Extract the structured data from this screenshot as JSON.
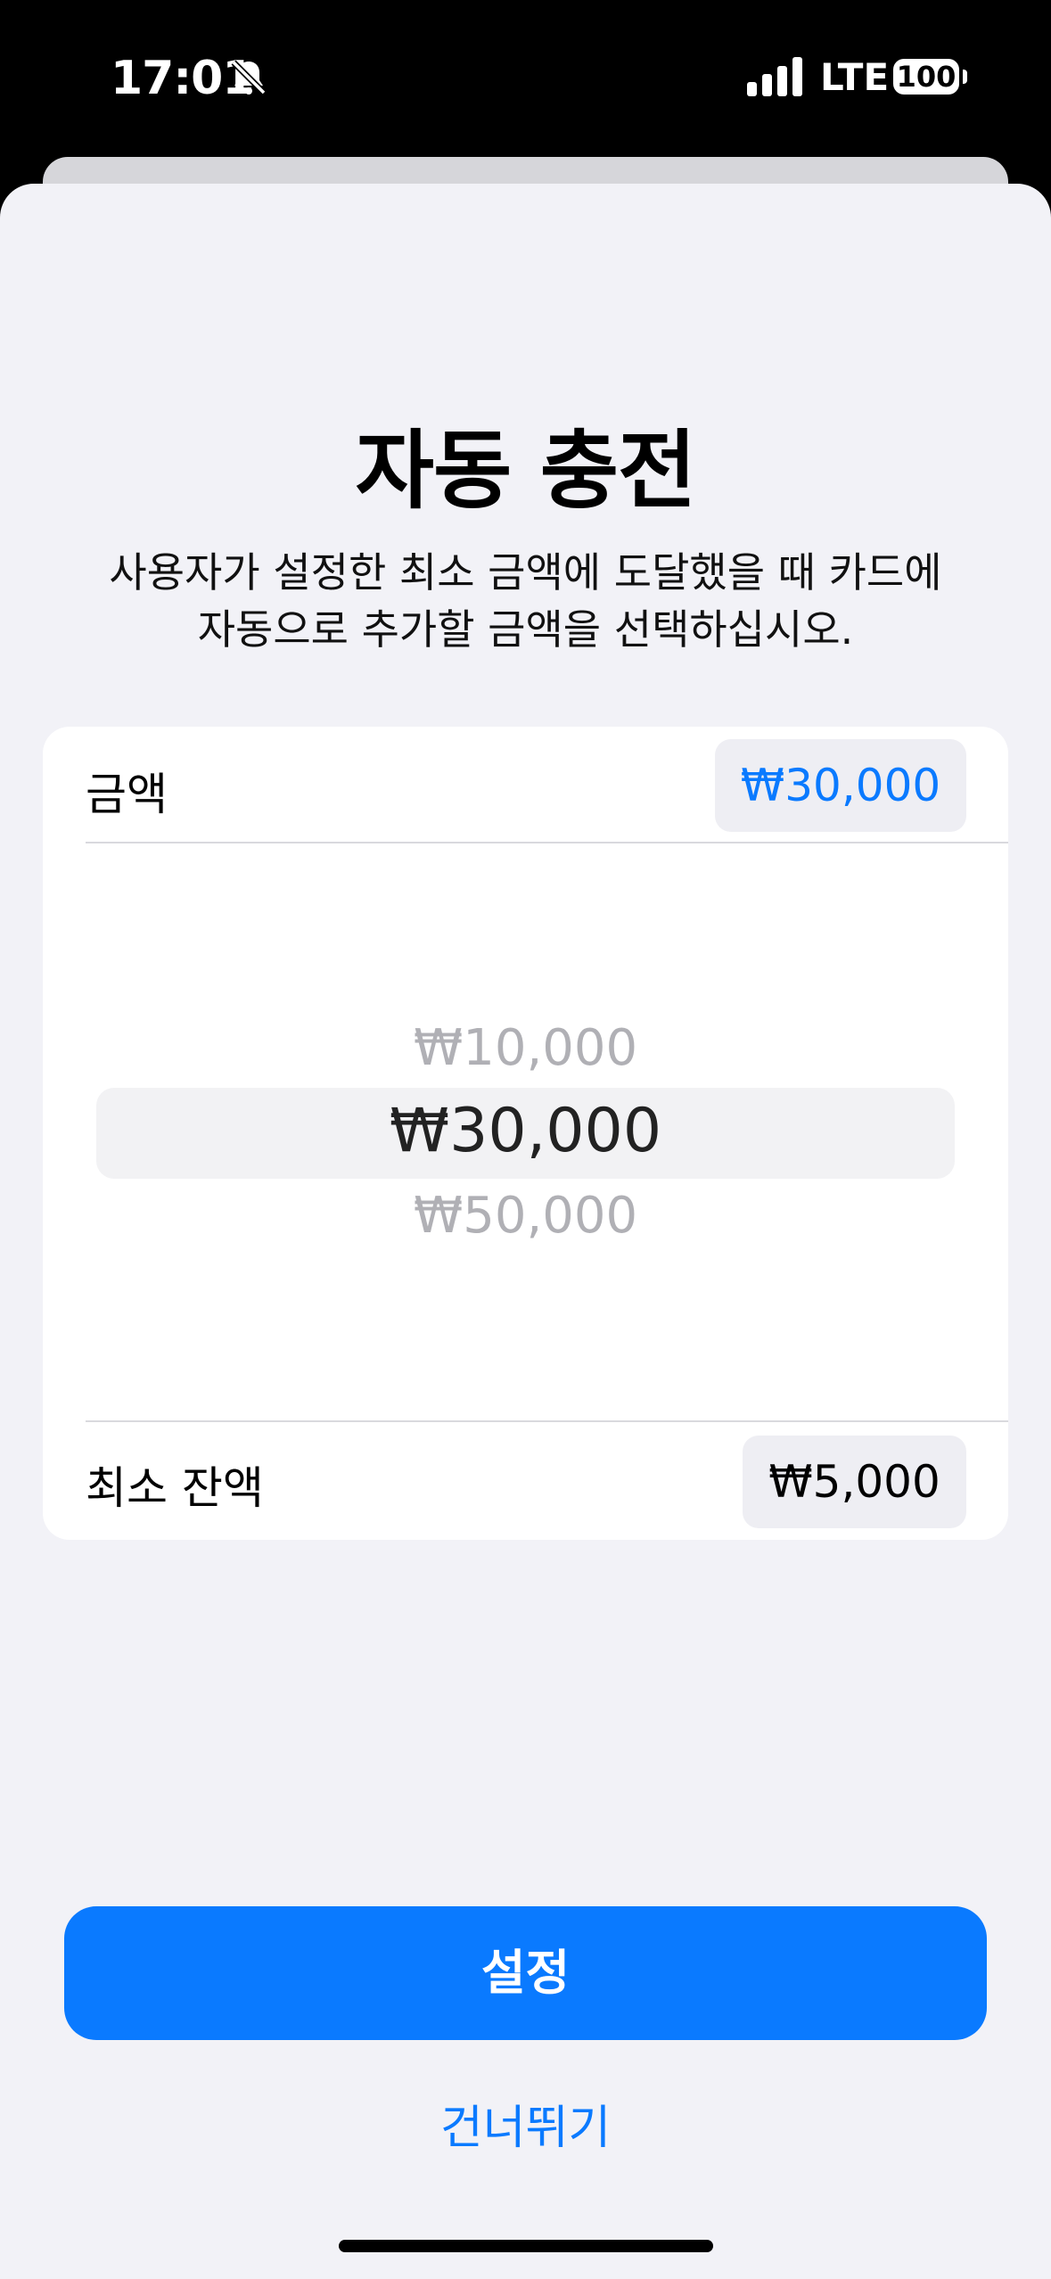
{
  "status_bar": {
    "time": "17:01",
    "network": "LTE",
    "battery": "100"
  },
  "sheet": {
    "title": "자동 충전",
    "subtitle_line1": "사용자가 설정한 최소 금액에 도달했을 때 카드에",
    "subtitle_line2": "자동으로 추가할 금액을 선택하십시오."
  },
  "amount_row": {
    "label": "금액",
    "value": "₩30,000"
  },
  "picker": {
    "options": [
      "₩10,000",
      "₩30,000",
      "₩50,000"
    ],
    "selected": "₩30,000"
  },
  "min_balance_row": {
    "label": "최소 잔액",
    "value": "₩5,000"
  },
  "actions": {
    "set_label": "설정",
    "skip_label": "건너뛰기"
  },
  "colors": {
    "accent": "#0a7aff",
    "background": "#f2f2f7"
  }
}
